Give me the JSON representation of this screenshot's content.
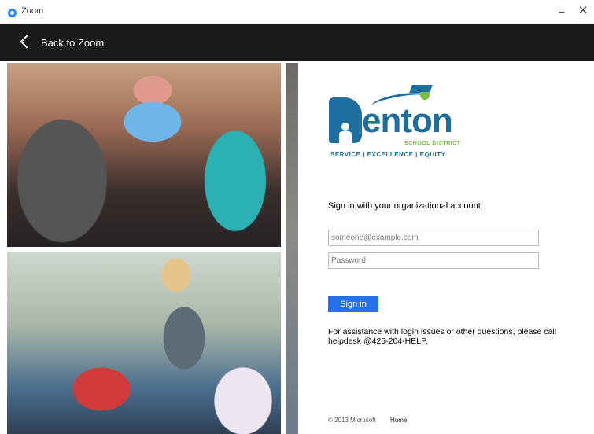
{
  "window": {
    "title": "Zoom",
    "minimize_glyph": "−",
    "close_glyph": "✕"
  },
  "nav": {
    "back_label": "Back to Zoom"
  },
  "logo": {
    "word": "enton",
    "district": "SCHOOL DISTRICT",
    "tagline": "SERVICE | EXCELLENCE | EQUITY",
    "colors": {
      "blue": "#1e6f9f",
      "green": "#7cc043"
    }
  },
  "signin": {
    "heading": "Sign in with your organizational account",
    "email_placeholder": "someone@example.com",
    "password_placeholder": "Password",
    "button_label": "Sign in",
    "help_text": "For assistance with login issues or other questions, please call helpdesk @425-204-HELP."
  },
  "footer": {
    "copyright": "© 2013 Microsoft",
    "home_link": "Home"
  },
  "colors": {
    "nav_bg": "#1a1a1a",
    "accent": "#2672ec",
    "zoom_blue": "#2d8cff"
  },
  "icons": {
    "app": "zoom-logo-icon",
    "back": "chevron-left-icon"
  }
}
